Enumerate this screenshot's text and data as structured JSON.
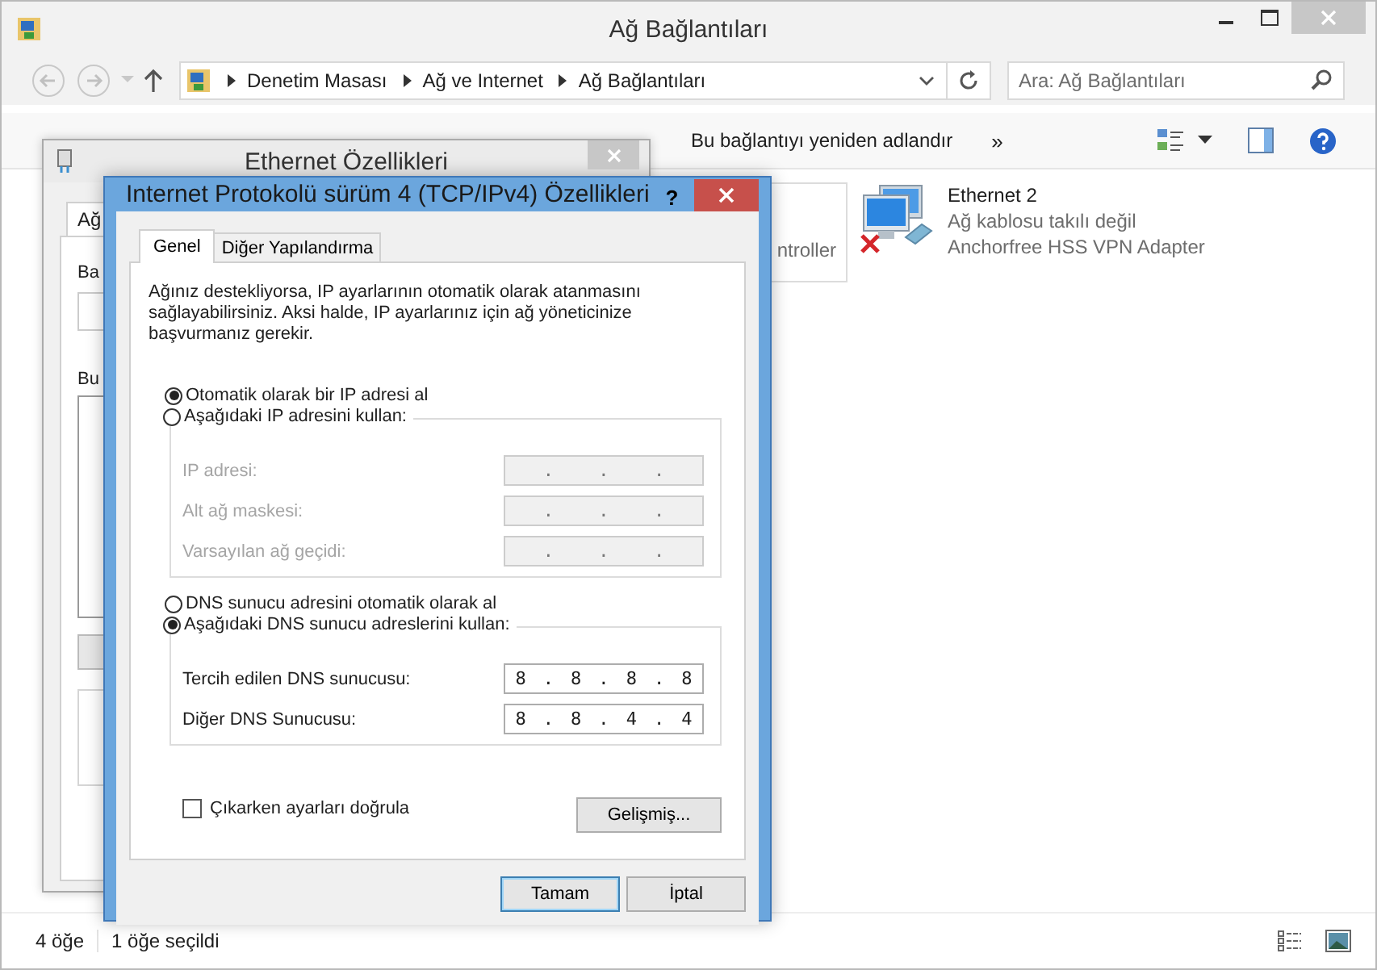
{
  "window": {
    "title": "Ağ Bağlantıları"
  },
  "address_bar": {
    "crumbs": [
      "Denetim Masası",
      "Ağ ve Internet",
      "Ağ Bağlantıları"
    ]
  },
  "search": {
    "placeholder": "Ara: Ağ Bağlantıları"
  },
  "toolbar": {
    "items": [
      "Bu bağlantıyı yeniden adlandır"
    ],
    "more": "»"
  },
  "partial_item": {
    "text": "ntroller"
  },
  "connection": {
    "name": "Ethernet 2",
    "status": "Ağ kablosu takılı değil",
    "device": "Anchorfree HSS VPN Adapter",
    "disconnected": true
  },
  "back_dialog": {
    "title": "Ethernet Özellikleri",
    "tab": "Ağ",
    "labels": [
      "Ba",
      "Bu"
    ]
  },
  "dialog": {
    "title": "Internet Protokolü sürüm 4 (TCP/IPv4) Özellikleri",
    "help": "?",
    "tabs": [
      {
        "label": "Genel",
        "selected": true
      },
      {
        "label": "Diğer Yapılandırma",
        "selected": false
      }
    ],
    "intro": "Ağınız destekliyorsa, IP ayarlarının otomatik olarak atanmasını sağlayabilirsiniz. Aksi halde, IP ayarlarınız için ağ yöneticinize başvurmanız gerekir.",
    "ip_options": [
      {
        "label": "Otomatik olarak bir IP adresi al",
        "selected": true
      },
      {
        "label": "Aşağıdaki IP adresini kullan:",
        "selected": false
      }
    ],
    "ip_fields": [
      {
        "label": "IP adresi:",
        "separator": ".",
        "disabled": true
      },
      {
        "label": "Alt ağ maskesi:",
        "separator": ".",
        "disabled": true
      },
      {
        "label": "Varsayılan ağ geçidi:",
        "separator": ".",
        "disabled": true
      }
    ],
    "dns_options": [
      {
        "label": "DNS sunucu adresini otomatik olarak al",
        "selected": false
      },
      {
        "label": "Aşağıdaki DNS sunucu adreslerini kullan:",
        "selected": true
      }
    ],
    "dns_fields": [
      {
        "label": "Tercih edilen DNS sunucusu:",
        "separator": ".",
        "octets": [
          "8",
          "8",
          "8",
          "8"
        ],
        "disabled": false
      },
      {
        "label": "Diğer DNS Sunucusu:",
        "separator": ".",
        "octets": [
          "8",
          "8",
          "4",
          "4"
        ],
        "disabled": false
      }
    ],
    "validate": {
      "label": "Çıkarken ayarları doğrula",
      "checked": false
    },
    "advanced": "Gelişmiş...",
    "buttons": [
      {
        "label": "Tamam",
        "default": true
      },
      {
        "label": "İptal",
        "default": false
      }
    ]
  },
  "status_bar": {
    "count": "4 öğe",
    "selected": "1 öğe seçildi"
  }
}
